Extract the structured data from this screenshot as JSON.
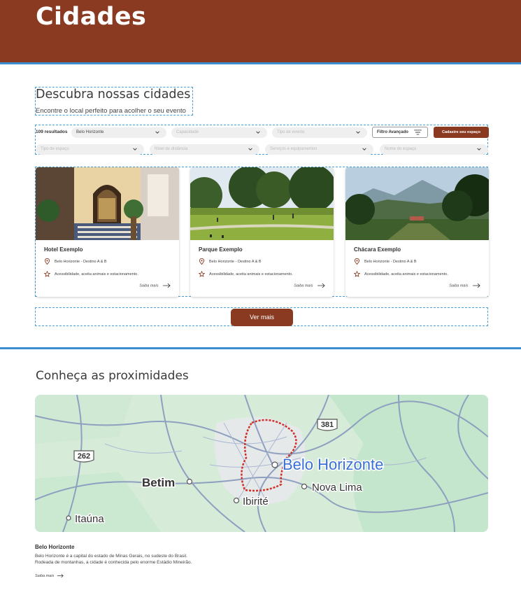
{
  "hero": {
    "title": "Cidades"
  },
  "intro": {
    "heading": "Descubra nossas cidades",
    "subheading": "Encontre o local perfeito para acolher o seu evento"
  },
  "filters": {
    "result_count": "109 resultados",
    "selects_row1": [
      {
        "value": "Belo Horizonte",
        "filled": true
      },
      {
        "value": "Capacidade",
        "filled": false
      },
      {
        "value": "Tipo de evento",
        "filled": false
      }
    ],
    "advanced_label": "Filtro Avançado",
    "cta_label": "Cadastre seu espaço",
    "selects_row2": [
      {
        "value": "Tipo de espaço",
        "filled": false
      },
      {
        "value": "Nível de distância",
        "filled": false
      },
      {
        "value": "Serviços e equipamentos",
        "filled": false
      },
      {
        "value": "Nome do espaço",
        "filled": false
      }
    ]
  },
  "cards": [
    {
      "title": "Hotel Exemplo",
      "location": "Belo Horizonte - Destino A & B",
      "features": "Acessibilidade, aceita animais e estacionamento.",
      "more": "Saiba mais"
    },
    {
      "title": "Parque Exemplo",
      "location": "Belo Horizonte - Destino A & B",
      "features": "Acessibilidade, aceita animais e estacionamento.",
      "more": "Saiba mais"
    },
    {
      "title": "Chácara Exemplo",
      "location": "Belo Horizonte - Destino A & B",
      "features": "Acessibilidade, aceita animais e estacionamento.",
      "more": "Saiba mais"
    }
  ],
  "ver_mais": "Ver mais",
  "nearby": {
    "heading": "Conheça as proximidades",
    "map_labels": {
      "belo_horizonte": "Belo Horizonte",
      "betim": "Betim",
      "nova_lima": "Nova Lima",
      "ibirite": "Ibirité",
      "itauna": "Itaúna",
      "highway_262": "262",
      "highway_381": "381"
    },
    "city_name": "Belo Horizonte",
    "city_desc_line1": "Belo Horizonte é a capital do estado de Minas Gerais, no sudeste do Brasil.",
    "city_desc_line2": "Rodeada de montanhas, a cidade é conhecida pelo enorme Estádio Mineirão.",
    "more": "Saiba mais"
  },
  "colors": {
    "brand": "#8b3a22",
    "accent": "#3b8fd0"
  }
}
